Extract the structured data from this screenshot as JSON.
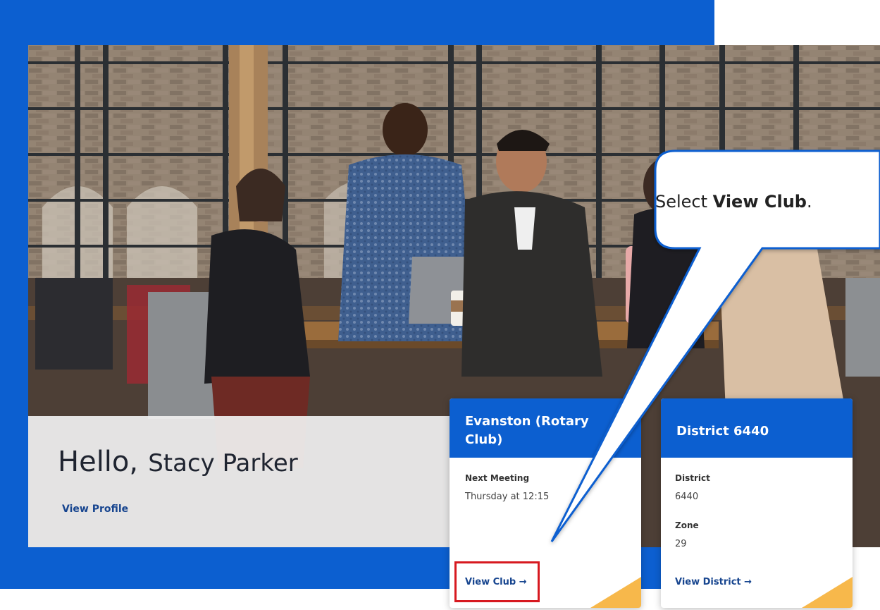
{
  "greeting": {
    "hello": "Hello,",
    "name": "Stacy Parker",
    "view_profile": "View Profile"
  },
  "club_card": {
    "title": "Evanston (Rotary Club)",
    "next_meeting_label": "Next Meeting",
    "next_meeting_value": "Thursday at 12:15",
    "link": "View Club →"
  },
  "district_card": {
    "title": "District 6440",
    "district_label": "District",
    "district_value": "6440",
    "zone_label": "Zone",
    "zone_value": "29",
    "link": "View District →"
  },
  "callout": {
    "prefix": "Select ",
    "bold": "View Club",
    "suffix": "."
  },
  "colors": {
    "brand_blue": "#0c5fd0",
    "link_navy": "#17458f",
    "accent_gold": "#f7b84b",
    "highlight_red": "#d71920"
  }
}
